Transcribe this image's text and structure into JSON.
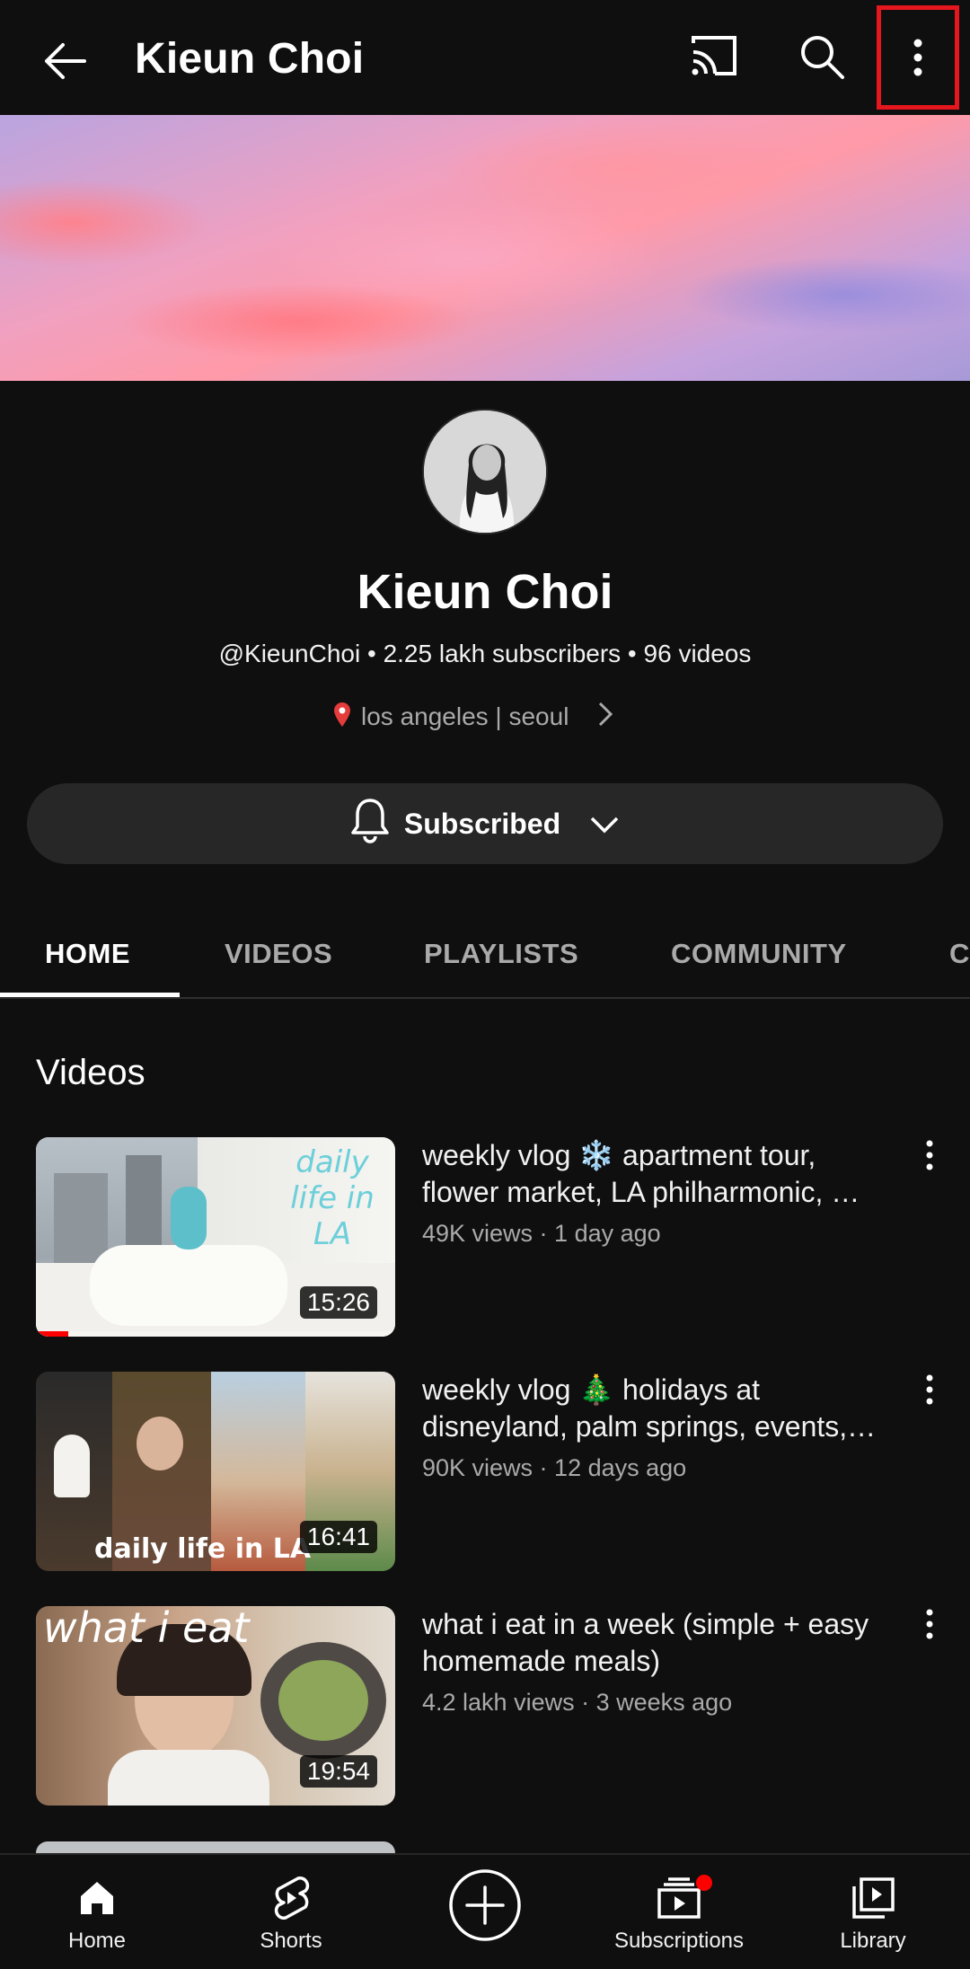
{
  "header": {
    "title": "Kieun Choi"
  },
  "channel": {
    "name": "Kieun Choi",
    "meta": "@KieunChoi • 2.25 lakh subscribers • 96 videos",
    "location": "los angeles | seoul",
    "subscribe_label": "Subscribed"
  },
  "tabs": [
    {
      "label": "HOME",
      "active": true
    },
    {
      "label": "VIDEOS"
    },
    {
      "label": "PLAYLISTS"
    },
    {
      "label": "COMMUNITY"
    },
    {
      "label": "C"
    }
  ],
  "section": {
    "title": "Videos"
  },
  "videos": [
    {
      "title": "weekly vlog ❄️ apartment tour, flower market, LA philharmonic, …",
      "meta": "49K views · 1 day ago",
      "duration": "15:26",
      "thumb_text": "daily life in LA",
      "watched_fraction": 0.09
    },
    {
      "title": "weekly vlog 🎄 holidays at disneyland, palm springs, events,…",
      "meta": "90K views · 12 days ago",
      "duration": "16:41",
      "thumb_text": "daily life in LA"
    },
    {
      "title": "what i eat in a week (simple + easy homemade meals)",
      "meta": "4.2 lakh views · 3 weeks ago",
      "duration": "19:54",
      "thumb_text": "what i eat"
    }
  ],
  "bottom_nav": [
    {
      "label": "Home",
      "icon": "home-icon"
    },
    {
      "label": "Shorts",
      "icon": "shorts-icon"
    },
    {
      "label": "",
      "icon": "create-icon"
    },
    {
      "label": "Subscriptions",
      "icon": "subscriptions-icon"
    },
    {
      "label": "Library",
      "icon": "library-icon"
    }
  ],
  "colors": {
    "background": "#0f0f0f",
    "highlight_box": "#e5161d",
    "progress": "#ff0000",
    "badge": "#ff0000"
  }
}
